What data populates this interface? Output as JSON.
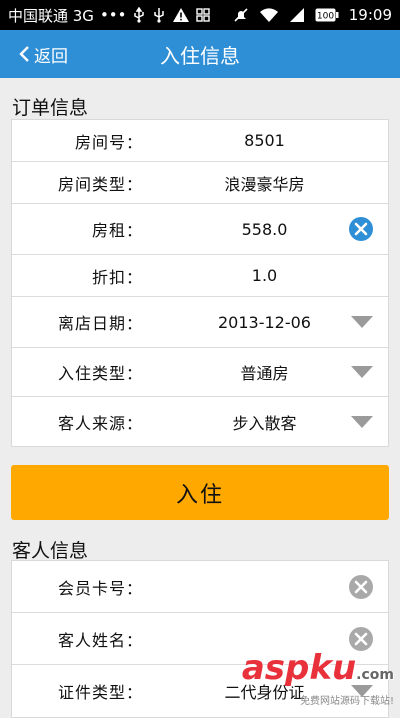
{
  "statusbar": {
    "carrier": "中国联通 3G",
    "dots": "•••",
    "battery": "100",
    "time": "19:09"
  },
  "navbar": {
    "back_label": "返回",
    "title": "入住信息"
  },
  "order_section": {
    "title": "订单信息",
    "rows": [
      {
        "label": "房间号：",
        "value": "8501",
        "trail": "none"
      },
      {
        "label": "房间类型：",
        "value": "浪漫豪华房",
        "trail": "none"
      },
      {
        "label": "房租：",
        "value": "558.0",
        "trail": "clear-blue"
      },
      {
        "label": "折扣：",
        "value": "1.0",
        "trail": "none"
      },
      {
        "label": "离店日期：",
        "value": "2013-12-06",
        "trail": "dropdown"
      },
      {
        "label": "入住类型：",
        "value": "普通房",
        "trail": "dropdown"
      },
      {
        "label": "客人来源：",
        "value": "步入散客",
        "trail": "dropdown"
      }
    ]
  },
  "checkin_button": {
    "label": "入住"
  },
  "guest_section": {
    "title": "客人信息",
    "rows": [
      {
        "label": "会员卡号：",
        "value": "",
        "trail": "clear-gray"
      },
      {
        "label": "客人姓名：",
        "value": "",
        "trail": "clear-gray"
      },
      {
        "label": "证件类型：",
        "value": "二代身份证",
        "trail": "dropdown"
      }
    ]
  },
  "watermark": {
    "logo": "asp",
    "logo_ku": "ku",
    "logo_com": ".com",
    "sub": "免费网站源码下载站!"
  },
  "colors": {
    "navbar": "#2f8fd6",
    "button": "#ffa800",
    "clear_blue": "#2f8fd6",
    "clear_gray": "#a9a9a9",
    "dropdown": "#9a9a9a"
  }
}
